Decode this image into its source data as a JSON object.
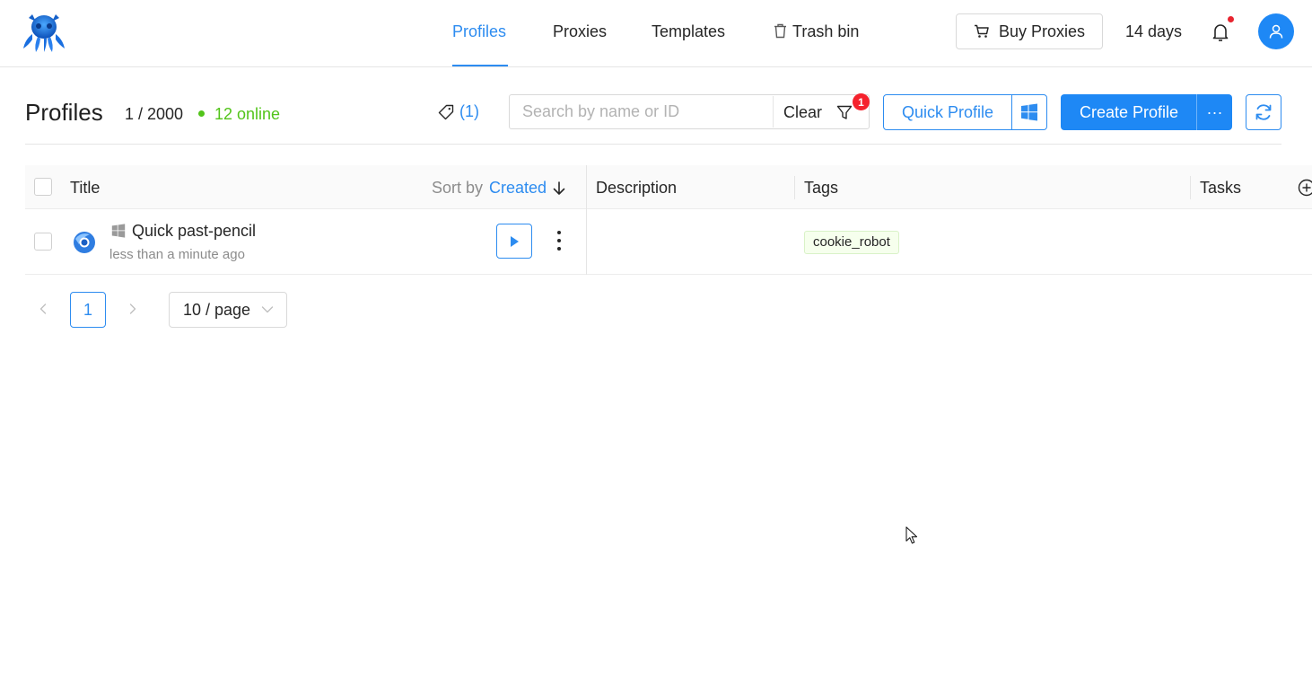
{
  "nav": {
    "items": [
      {
        "label": "Profiles",
        "active": true
      },
      {
        "label": "Proxies",
        "active": false
      },
      {
        "label": "Templates",
        "active": false
      },
      {
        "label": "Trash bin",
        "active": false
      }
    ],
    "buy_label": "Buy Proxies",
    "days_label": "14 days"
  },
  "toolbar": {
    "title": "Profiles",
    "count": "1 / 2000",
    "online": "12 online",
    "tag_count": "(1)",
    "search_placeholder": "Search by name or ID",
    "clear_label": "Clear",
    "filter_badge": "1",
    "quick_profile_label": "Quick Profile",
    "create_profile_label": "Create Profile",
    "more_label": "···"
  },
  "table": {
    "headers": {
      "title": "Title",
      "sort_prefix": "Sort by",
      "sort_value": "Created",
      "description": "Description",
      "tags": "Tags",
      "tasks": "Tasks"
    },
    "rows": [
      {
        "title": "Quick past-pencil",
        "subtitle": "less than a minute ago",
        "description": "",
        "tag": "cookie_robot",
        "os_icon": "windows-icon"
      }
    ]
  },
  "pagination": {
    "current_page": "1",
    "page_size": "10 / page"
  },
  "colors": {
    "accent": "#1e88f5",
    "link": "#2d8cf0",
    "online": "#52c41a",
    "badge": "#f5222d"
  }
}
